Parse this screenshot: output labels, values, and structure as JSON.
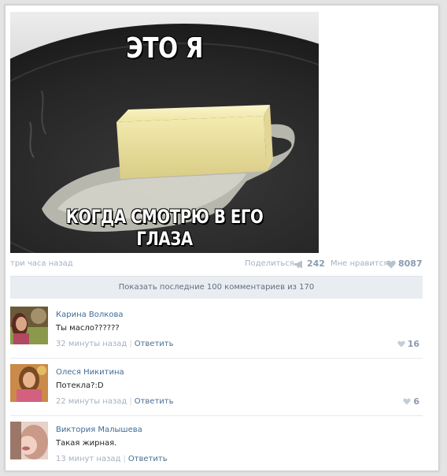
{
  "post": {
    "meme_top": "ЭТО Я",
    "meme_bottom": "КОГДА СМОТРЮ В ЕГО ГЛАЗА",
    "time": "три часа назад",
    "share_label": "Поделиться",
    "share_count": "242",
    "like_label": "Мне нравится",
    "like_count": "8087"
  },
  "show_all": "Показать последние 100 комментариев из 170",
  "comments": [
    {
      "author": "Карина Волкова",
      "text": "Ты масло??????",
      "time": "32 минуты назад",
      "reply": "Ответить",
      "likes": "16"
    },
    {
      "author": "Олеся Никитина",
      "text": "Потекла?:D",
      "time": "22 минуты назад",
      "reply": "Ответить",
      "likes": "6"
    },
    {
      "author": "Виктория Малышева",
      "text": "Такая жирная.",
      "time": "13 минут назад",
      "reply": "Ответить",
      "likes": ""
    }
  ],
  "colors": {
    "link": "#3f6b98",
    "meta": "#a5b1bf",
    "bar": "#e9edf1"
  },
  "icons": {
    "share": "megaphone-icon",
    "like": "heart-icon"
  }
}
